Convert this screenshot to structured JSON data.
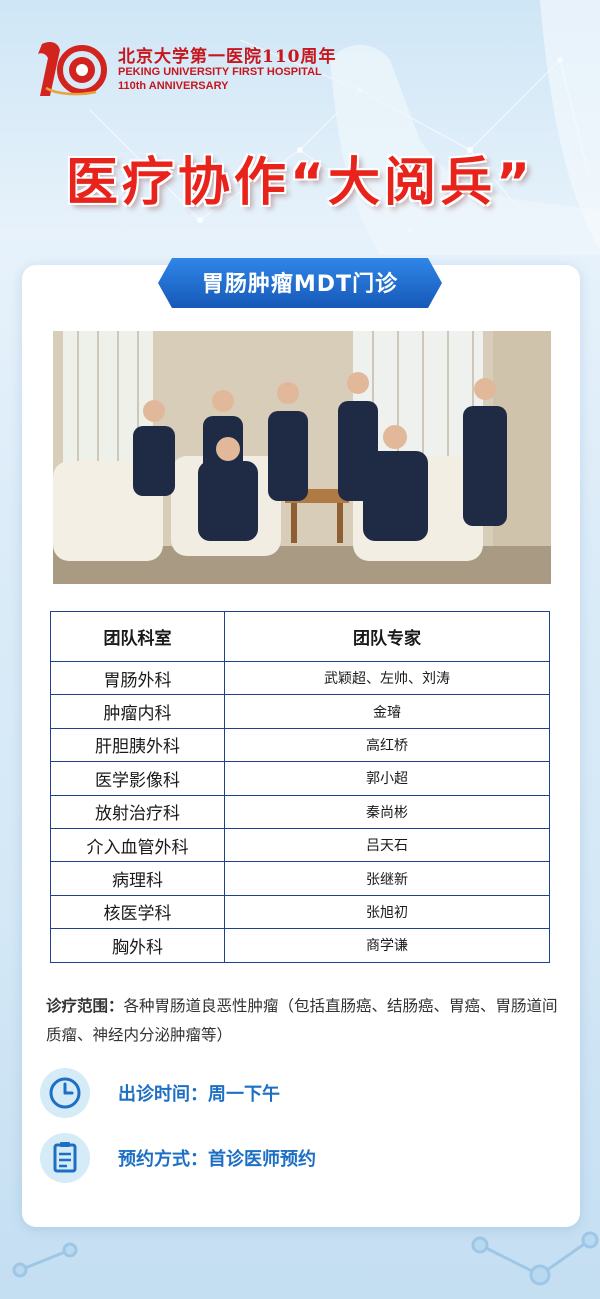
{
  "header": {
    "logo_cn": "北京大学第一医院110周年",
    "logo_en_line1": "PEKING UNIVERSITY FIRST HOSPITAL",
    "logo_en_line2": "110th ANNIVERSARY",
    "title": "医疗协作“大阅兵”"
  },
  "card": {
    "banner": "胃肠肿瘤MDT门诊",
    "table": {
      "headers": [
        "团队科室",
        "团队专家"
      ],
      "rows": [
        {
          "dept": "胃肠外科",
          "experts": "武颖超、左帅、刘涛"
        },
        {
          "dept": "肿瘤内科",
          "experts": "金璿"
        },
        {
          "dept": "肝胆胰外科",
          "experts": "高红桥"
        },
        {
          "dept": "医学影像科",
          "experts": "郭小超"
        },
        {
          "dept": "放射治疗科",
          "experts": "秦尚彬"
        },
        {
          "dept": "介入血管外科",
          "experts": "吕天石"
        },
        {
          "dept": "病理科",
          "experts": "张继新"
        },
        {
          "dept": "核医学科",
          "experts": "张旭初"
        },
        {
          "dept": "胸外科",
          "experts": "商学谦"
        }
      ]
    },
    "scope": {
      "label": "诊疗范围：",
      "text": "各种胃肠道良恶性肿瘤（包括直肠癌、结肠癌、胃癌、胃肠道间质瘤、神经内分泌肿瘤等）"
    },
    "clinic_time": "出诊时间：周一下午",
    "appointment": "预约方式：首诊医师预约"
  },
  "colors": {
    "brand_red": "#c8161d",
    "title_red": "#e8231c",
    "banner_blue": "#1f6fd0",
    "table_border": "#1f3f8f",
    "info_blue": "#1d6fc4"
  },
  "icons": {
    "clock": "clock-icon",
    "appointment": "clipboard-icon"
  }
}
